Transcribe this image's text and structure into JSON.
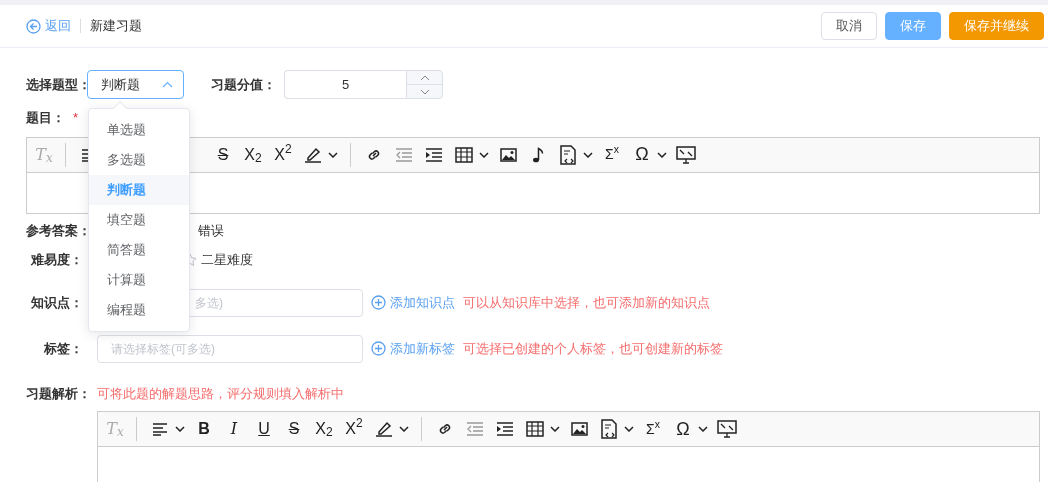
{
  "header": {
    "back": "返回",
    "title": "新建习题",
    "buttons": [
      {
        "label": "取消",
        "kind": "default"
      },
      {
        "label": "保存",
        "kind": "primary"
      },
      {
        "label": "保存并继续",
        "kind": "warning"
      }
    ]
  },
  "type_select": {
    "label": "选择题型：",
    "value": "判断题",
    "expanded": true,
    "options": [
      {
        "label": "单选题",
        "selected": false
      },
      {
        "label": "多选题",
        "selected": false
      },
      {
        "label": "判断题",
        "selected": true
      },
      {
        "label": "填空题",
        "selected": false
      },
      {
        "label": "简答题",
        "selected": false
      },
      {
        "label": "计算题",
        "selected": false
      },
      {
        "label": "编程题",
        "selected": false
      }
    ]
  },
  "score": {
    "label": "习题分值：",
    "value": "5"
  },
  "stem": {
    "label": "题目：",
    "required_mark": "*",
    "toolbar": [
      {
        "kind": "clear",
        "label": "T$_{x}$"
      },
      {
        "kind": "sep"
      },
      {
        "kind": "align"
      },
      {
        "kind": "covered"
      },
      {
        "kind": "strike",
        "label": "S"
      },
      {
        "kind": "sub",
        "label": "X$_{2}$"
      },
      {
        "kind": "sup",
        "label": "X$^{2}$"
      },
      {
        "kind": "highlight"
      },
      {
        "kind": "caret"
      },
      {
        "kind": "sep"
      },
      {
        "kind": "link"
      },
      {
        "kind": "outdent"
      },
      {
        "kind": "indent"
      },
      {
        "kind": "table"
      },
      {
        "kind": "caret"
      },
      {
        "kind": "image"
      },
      {
        "kind": "music"
      },
      {
        "kind": "code"
      },
      {
        "kind": "caret"
      },
      {
        "kind": "sigma",
        "label": "Σ$^{x}$"
      },
      {
        "kind": "omega",
        "label": "Ω"
      },
      {
        "kind": "caret"
      },
      {
        "kind": "fullscreen"
      }
    ]
  },
  "answer": {
    "label": "参考答案：",
    "option": "错误"
  },
  "difficulty": {
    "label": "难易度：",
    "text": "二星难度"
  },
  "knowledge": {
    "label": "知识点：",
    "placeholder": "多选)",
    "add": "添加知识点",
    "hint": "可以从知识库中选择，也可添加新的知识点"
  },
  "tags": {
    "label": "标签：",
    "placeholder": "请选择标签(可多选)",
    "add": "添加新标签",
    "hint": "可选择已创建的个人标签，也可创建新的标签"
  },
  "analysis": {
    "label": "习题解析：",
    "hint": "可将此题的解题思路，评分规则填入解析中",
    "toolbar": [
      {
        "kind": "clear",
        "label": "T$_{x}$"
      },
      {
        "kind": "sep"
      },
      {
        "kind": "align"
      },
      {
        "kind": "caret"
      },
      {
        "kind": "bold",
        "label": "B"
      },
      {
        "kind": "italic",
        "label": "I"
      },
      {
        "kind": "underline",
        "label": "U"
      },
      {
        "kind": "strike",
        "label": "S"
      },
      {
        "kind": "sub",
        "label": "X$_{2}$"
      },
      {
        "kind": "sup",
        "label": "X$^{2}$"
      },
      {
        "kind": "highlight"
      },
      {
        "kind": "caret"
      },
      {
        "kind": "sep"
      },
      {
        "kind": "link"
      },
      {
        "kind": "outdent"
      },
      {
        "kind": "indent"
      },
      {
        "kind": "table"
      },
      {
        "kind": "caret"
      },
      {
        "kind": "image"
      },
      {
        "kind": "code"
      },
      {
        "kind": "caret"
      },
      {
        "kind": "sigma",
        "label": "Σ$^{x}$"
      },
      {
        "kind": "omega",
        "label": "Ω"
      },
      {
        "kind": "caret"
      },
      {
        "kind": "fullscreen"
      }
    ]
  }
}
